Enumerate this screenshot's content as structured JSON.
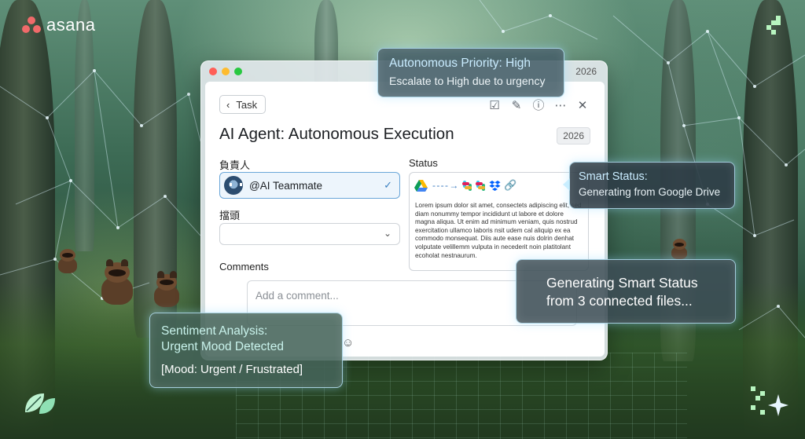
{
  "brand": {
    "name": "asana"
  },
  "window": {
    "year_label": "2026"
  },
  "task": {
    "back_label": "Task",
    "title": "AI Agent: Autonomous Execution",
    "year_badge": "2026",
    "assignee_label": "負責人",
    "assignee_value": "@AI Teammate",
    "topic_label": "擋頭",
    "status_label": "Status",
    "status_text": "Lorem ipsum dolor sit amet, consectets adipiscing elit, sed diam nonummy tempor incididunt ut labore et dolore magna aliqua.  Ut enim ad minimum veniam, quis nostrud exercitation ullamco laboris nsit udem cal aliquip ex ea commodo monsequat. Diis aute ease nuis dolrin denhat volputate velillemm vulputa in necederit noin platitolant ecoholat nestnaurum.",
    "comments_label": "Comments",
    "comment_placeholder": "Add a comment..."
  },
  "toolbar_icons": [
    "checkbox-icon",
    "pencil-icon",
    "info-icon",
    "more-icon",
    "close-icon"
  ],
  "integrations": [
    "google-drive-icon",
    "arrow-icon",
    "slack-icon",
    "slack-icon",
    "dropbox-icon",
    "link-icon"
  ],
  "cards": {
    "priority": {
      "title": "Autonomous Priority: High",
      "subtitle": "Escalate to High due to urgency"
    },
    "smart_status": {
      "title": "Smart Status:",
      "subtitle": "Generating from Google Drive"
    },
    "generating": {
      "line1": "Generating Smart Status",
      "line2": "from 3 connected files..."
    },
    "sentiment": {
      "title_line1": "Sentiment Analysis:",
      "title_line2": "Urgent Mood Detected",
      "value": "[Mood: Urgent / Frustrated]"
    }
  },
  "colors": {
    "brand_coral": "#f06a6a",
    "accent_blue": "#3a7fc0",
    "card_border": "#bfeaff",
    "mac_red": "#ff5f57",
    "mac_yellow": "#febc2e",
    "mac_green": "#28c840"
  }
}
